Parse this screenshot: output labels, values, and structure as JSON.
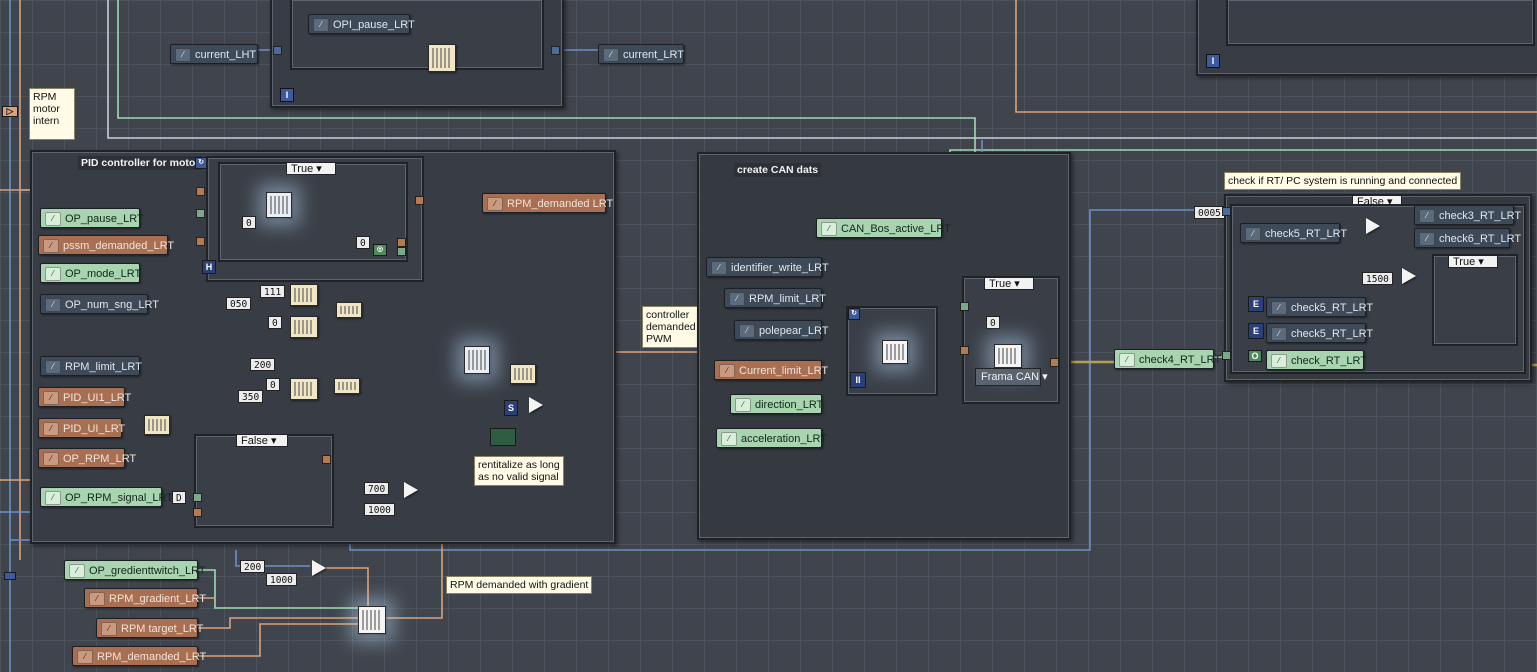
{
  "top": {
    "opi_pause": "OPI_pause_LRT",
    "current_in": "current_LHT",
    "current_out": "current_LRT",
    "info_glyph": "I",
    "rpm_note": "RPM\nmotor\nintern"
  },
  "pid": {
    "title": "PID controller for motor",
    "case_true": "True",
    "case_false": "False",
    "op_pause": "OP_pause_LRT",
    "pssm": "pssm_demanded_LRT",
    "op_mode": "OP_mode_LRT",
    "op_num": "OP_num_sng_LRT",
    "rpm_limit": "RPM_limit_LRT",
    "pid_ui1": "PID_UI1_LRT",
    "pid_ui": "PID_UI_LRT",
    "op_rpm": "OP_RPM_LRT",
    "op_rpm_signal": "OP_RPM_signal_LRT",
    "rpm_demanded": "RPM_demanded LRT",
    "c_050": "050",
    "c_111": "111",
    "c_0a": "0",
    "c_0b": "0",
    "c_0c": "0",
    "c_0d": "0",
    "c_200": "200",
    "c_350": "350",
    "c_700": "700",
    "c_1000": "1000",
    "c_d": "D",
    "c_s": "S",
    "h_glyph": "H",
    "retry_note": "rentitalize as long\nas no valid signal"
  },
  "middle": {
    "controller_note": "controller\ndemanded\nPWM"
  },
  "can": {
    "title": "create CAN dats",
    "can_bos": "CAN_Bos_active_LRT",
    "identifier": "identifier_write_LRT",
    "rpm_limit": "RPM_limit_LRT",
    "polepear": "polepear_LRT",
    "current_limit": "Current_limit_LRT",
    "direction": "direction_LRT",
    "acceleration": "acceleration_LRT",
    "case_true": "True",
    "frame": "Frama CAN",
    "pause_glyph": "II"
  },
  "check": {
    "note": "check if RT/ PC system is running and connected",
    "const_left": "0005",
    "case_false": "False",
    "case_true": "True",
    "check5a": "check5_RT_LRT",
    "check3": "check3_RT_LRT",
    "check6": "check6_RT_LRT",
    "c_1500": "1500",
    "check5b": "check5_RT_LRT",
    "check5c": "check5_RT_LRT",
    "check_rt": "check_RT_LRT",
    "check4": "check4_RT_LRT",
    "e_glyph": "E",
    "o_glyph": "O"
  },
  "gradient": {
    "note": "RPM demanded with gradient",
    "op_gradient": "OP_gredienttwitch_LRT",
    "rpm_gradient": "RPM_gradient_LRT",
    "rpm_target": "RPM target_LRT",
    "rpm_demanded": "RPM_demanded_LRT",
    "c_200": "200",
    "c_1000": "1000"
  },
  "colors": {
    "wire_orange": "#d9a27a",
    "wire_green": "#9fd9b3",
    "wire_blue": "#6b8fc8",
    "wire_pink": "#d9a6e0",
    "control_green": "#a8d4b0",
    "indicator_orange": "#a86f52"
  }
}
